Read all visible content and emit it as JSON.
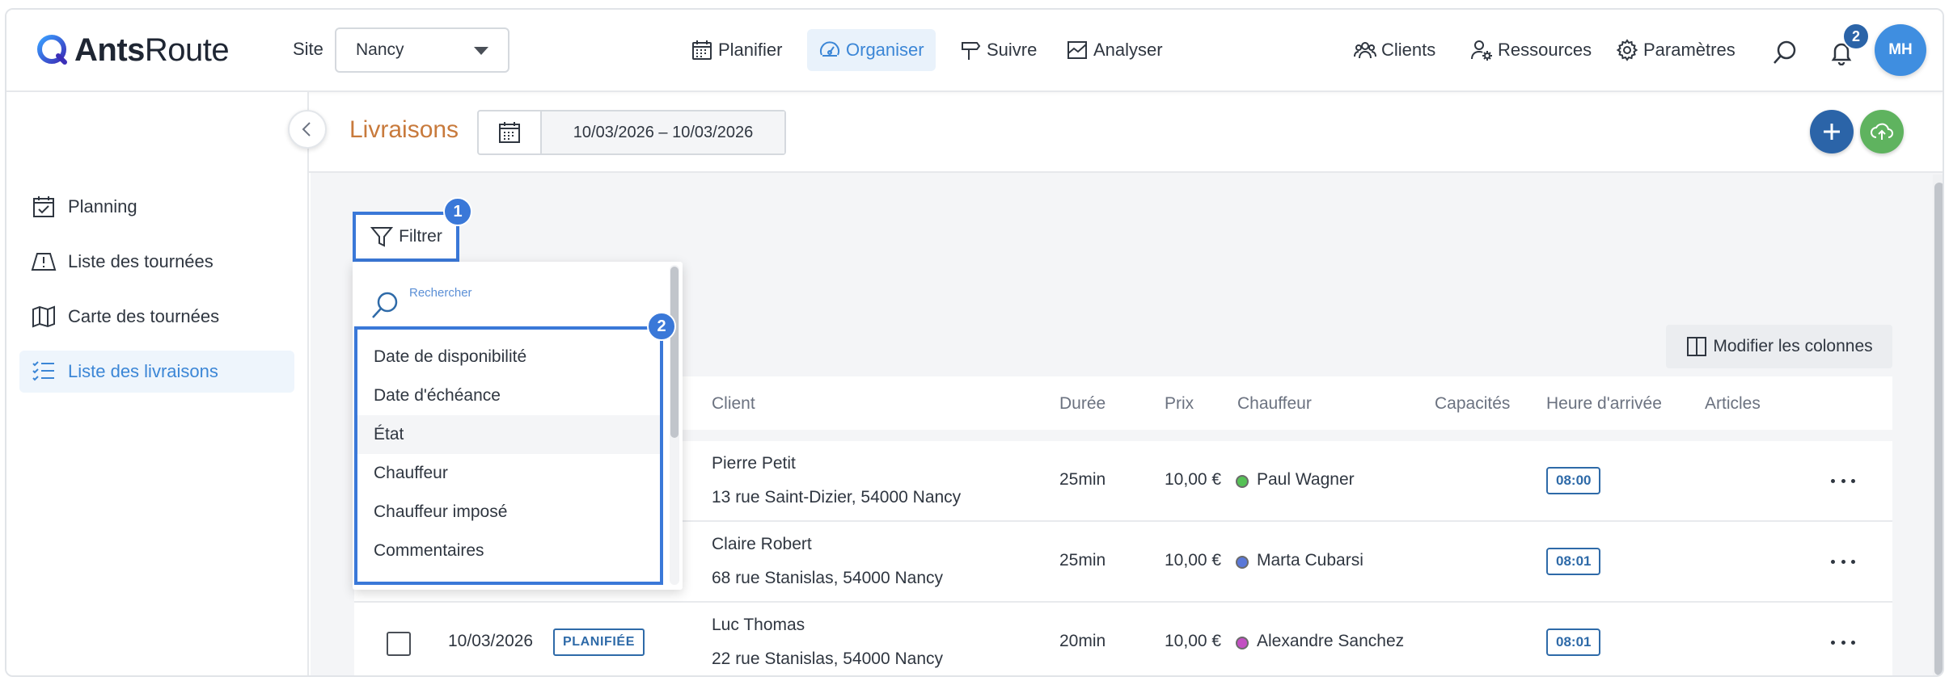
{
  "brand": {
    "name_bold": "Ants",
    "name_light": "Route"
  },
  "site": {
    "label": "Site",
    "value": "Nancy"
  },
  "nav": {
    "items": [
      {
        "label": "Planifier",
        "icon": "calendar-icon"
      },
      {
        "label": "Organiser",
        "icon": "speedometer-icon",
        "active": true
      },
      {
        "label": "Suivre",
        "icon": "signpost-icon"
      },
      {
        "label": "Analyser",
        "icon": "chart-icon"
      }
    ],
    "right": [
      {
        "label": "Clients",
        "icon": "people-icon"
      },
      {
        "label": "Ressources",
        "icon": "user-gear-icon"
      },
      {
        "label": "Paramètres",
        "icon": "gear-icon"
      }
    ],
    "notifications_count": "2",
    "avatar_initials": "MH"
  },
  "sidebar": {
    "items": [
      {
        "label": "Planning",
        "icon": "calendar-check-icon"
      },
      {
        "label": "Liste des tournées",
        "icon": "route-list-icon"
      },
      {
        "label": "Carte des tournées",
        "icon": "map-icon"
      },
      {
        "label": "Liste des livraisons",
        "icon": "checklist-icon",
        "active": true
      }
    ]
  },
  "page": {
    "title": "Livraisons",
    "date_range": "10/03/2026 – 10/03/2026"
  },
  "toolbar": {
    "filter_label": "Filtrer",
    "modify_columns_label": "Modifier les colonnes"
  },
  "steps": {
    "one": "1",
    "two": "2"
  },
  "filter_dropdown": {
    "search_placeholder": "Rechercher",
    "options": [
      "Date de disponibilité",
      "Date d'échéance",
      "État",
      "Chauffeur",
      "Chauffeur imposé",
      "Commentaires"
    ]
  },
  "table": {
    "columns": [
      "Client",
      "Durée",
      "Prix",
      "Chauffeur",
      "Capacités",
      "Heure d'arrivée",
      "Articles"
    ],
    "rows": [
      {
        "date": "",
        "status": "",
        "client_name": "Pierre Petit",
        "client_address": "13 rue Saint-Dizier, 54000 Nancy",
        "duration": "25min",
        "price": "10,00 €",
        "driver": "Paul Wagner",
        "driver_color": "#55c155",
        "arrival": "08:00"
      },
      {
        "date": "",
        "status": "",
        "client_name": "Claire Robert",
        "client_address": "68 rue Stanislas, 54000 Nancy",
        "duration": "25min",
        "price": "10,00 €",
        "driver": "Marta Cubarsi",
        "driver_color": "#5a78d8",
        "arrival": "08:01"
      },
      {
        "date": "10/03/2026",
        "status": "PLANIFIÉE",
        "client_name": "Luc Thomas",
        "client_address": "22 rue Stanislas, 54000 Nancy",
        "duration": "20min",
        "price": "10,00 €",
        "driver": "Alexandre Sanchez",
        "driver_color": "#c24fc2",
        "arrival": "08:01"
      }
    ]
  },
  "colors": {
    "accent": "#3a78d8",
    "title": "#c87a3c",
    "add_button": "#2b64a8",
    "upload_button": "#5fb35f"
  }
}
